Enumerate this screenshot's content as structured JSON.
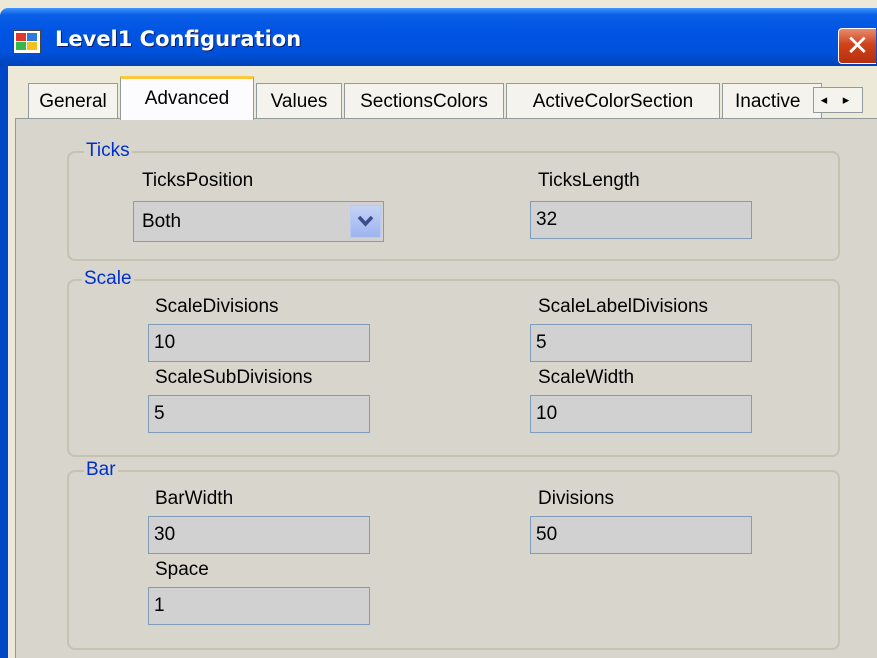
{
  "window": {
    "title": "Level1 Configuration",
    "close_glyph": "✕"
  },
  "tabs": [
    {
      "label": "General"
    },
    {
      "label": "Advanced"
    },
    {
      "label": "Values"
    },
    {
      "label": "SectionsColors"
    },
    {
      "label": "ActiveColorSection"
    },
    {
      "label": "Inactive"
    }
  ],
  "tab_scroll": {
    "glyph": "◂ ▸"
  },
  "ticks": {
    "title": "Ticks",
    "position_label": "TicksPosition",
    "position_value": "Both",
    "length_label": "TicksLength",
    "length_value": "32"
  },
  "scale": {
    "title": "Scale",
    "divisions_label": "ScaleDivisions",
    "divisions_value": "10",
    "label_divisions_label": "ScaleLabelDivisions",
    "label_divisions_value": "5",
    "sub_divisions_label": "ScaleSubDivisions",
    "sub_divisions_value": "5",
    "width_label": "ScaleWidth",
    "width_value": "10"
  },
  "bar": {
    "title": "Bar",
    "width_label": "BarWidth",
    "width_value": "30",
    "divisions_label": "Divisions",
    "divisions_value": "50",
    "space_label": "Space",
    "space_value": "1"
  }
}
